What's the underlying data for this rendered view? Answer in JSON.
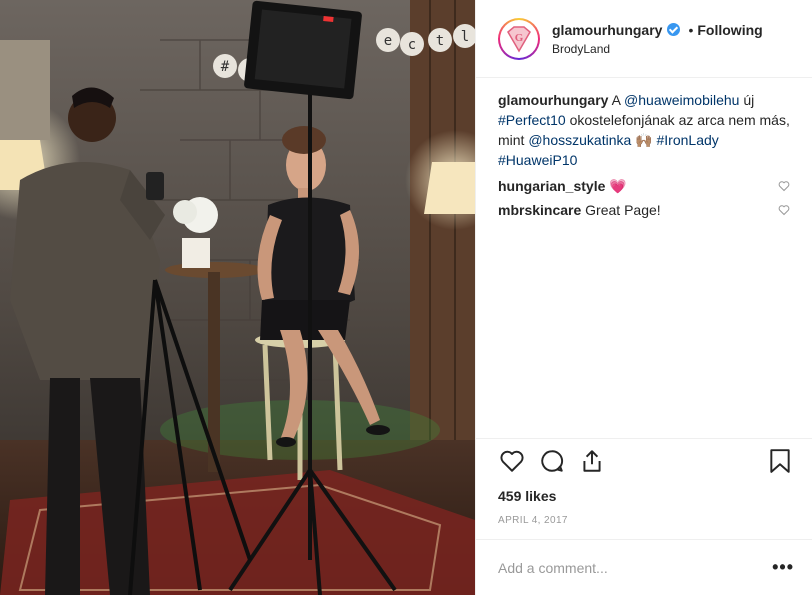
{
  "post": {
    "username": "glamourhungary",
    "follow_status": "Following",
    "separator": "•",
    "location": "BrodyLand",
    "avatar_letter": "G",
    "caption": {
      "username": "glamourhungary",
      "text_1": " A ",
      "mention_1": "@huaweimobilehu",
      "text_2": " új ",
      "hashtag_1": "#Perfect10",
      "text_3": " okostelefonjának az arca nem más, mint ",
      "mention_2": "@hosszukatinka",
      "emoji": " 🙌🏽 ",
      "hashtag_2": "#IronLady",
      "hashtag_3": "#HuaweiP10"
    },
    "comments": [
      {
        "user": "hungarian_style",
        "text": " 💗"
      },
      {
        "user": "mbrskincare",
        "text": " Great Page!"
      }
    ],
    "likes": "459 likes",
    "date": "APRIL 4, 2017",
    "add_comment_placeholder": "Add a comment...",
    "more_label": "•••"
  },
  "photo": {
    "sign_letters": [
      "#",
      "p",
      "e",
      "c",
      "t",
      "l"
    ]
  }
}
